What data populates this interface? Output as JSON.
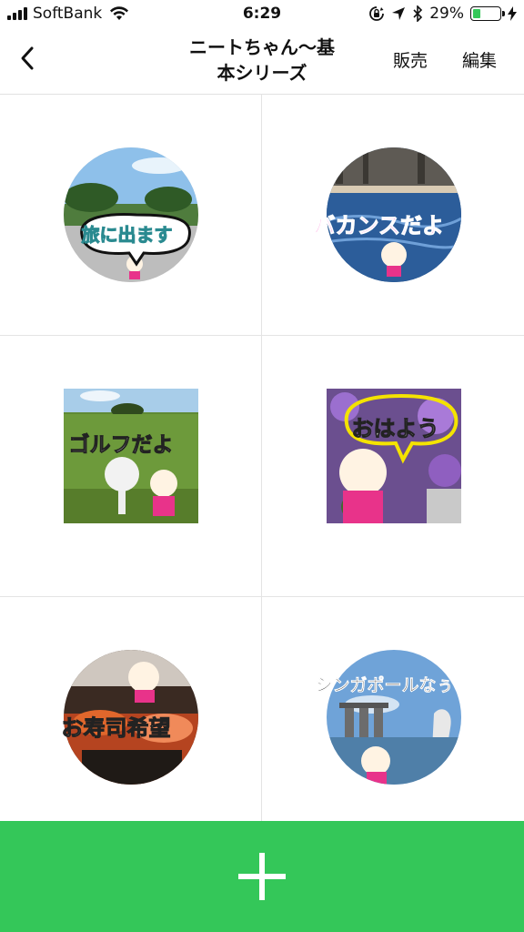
{
  "status_bar": {
    "carrier": "SoftBank",
    "time": "6:29",
    "battery": "29%",
    "battery_level": 0.29,
    "icons": [
      "signal-icon",
      "wifi-icon",
      "orientation-lock-icon",
      "location-icon",
      "bluetooth-icon",
      "battery-icon",
      "charging-icon"
    ]
  },
  "nav": {
    "title_line1": "ニートちゃん〜基",
    "title_line2": "本シリーズ",
    "sell_label": "販売",
    "edit_label": "編集",
    "back_icon": "chevron-left-icon"
  },
  "stickers": [
    {
      "caption": "旅に出ます",
      "caption_color": "#7fe3e6",
      "shape": "circle",
      "scene": "beach-trees"
    },
    {
      "caption": "バカンスだよ",
      "caption_color": "#ff4fc8",
      "shape": "circle",
      "scene": "pool"
    },
    {
      "caption": "ゴルフだよ",
      "caption_color": "#ffffff",
      "shape": "square",
      "scene": "golf-course"
    },
    {
      "caption": "おはよう",
      "caption_color": "#ffffff",
      "shape": "square",
      "scene": "purple-flowers"
    },
    {
      "caption": "お寿司希望",
      "caption_color": "#ffffff",
      "shape": "circle",
      "scene": "sushi"
    },
    {
      "caption": "シンガポールなぅ",
      "caption_color": "#111111",
      "shape": "circle",
      "scene": "singapore-bay"
    }
  ],
  "add_button": {
    "icon": "plus-icon",
    "color": "#34c759"
  }
}
